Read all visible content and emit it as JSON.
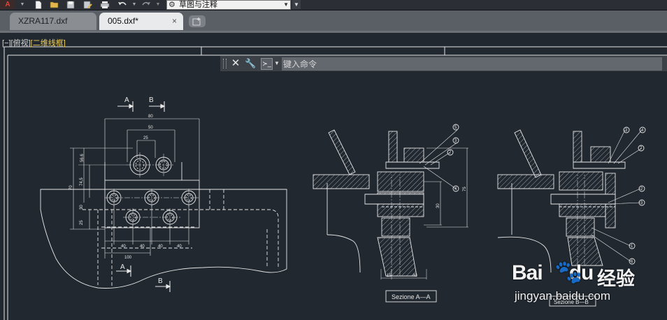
{
  "quick_access": {
    "app_menu_icon": "autocad-app-menu-icon",
    "tools": [
      "new-icon",
      "open-icon",
      "save-icon",
      "saveas-icon",
      "print-icon",
      "undo-icon",
      "redo-icon"
    ]
  },
  "workspace": {
    "label": "草图与注释"
  },
  "tabs": [
    {
      "label": "XZRA117.dxf",
      "active": false
    },
    {
      "label": "005.dxf*",
      "active": true,
      "close": "×"
    }
  ],
  "viewport_label": {
    "controls": "[−]",
    "view": "[俯视]",
    "style": "[二维线框]"
  },
  "command_line": {
    "placeholder": "键入命令"
  },
  "drawing": {
    "front_view": {
      "section_a_tag": "A",
      "section_b_tag": "B",
      "dim_top_80": "80",
      "dim_top_50": "50",
      "dim_top_25": "25",
      "dim_left_56_6": "56.6",
      "dim_left_70": "70",
      "dim_left_74_5": "74,5",
      "dim_left_30": "30",
      "dim_left_25": "25",
      "dim_bottom_40a": "40",
      "dim_bottom_40b": "40",
      "dim_bottom_40c": "40",
      "dim_bottom_40d": "40",
      "dim_bottom_100": "100"
    },
    "section_aa": {
      "balloons": [
        "5",
        "3",
        "7",
        "4"
      ],
      "dim_75": "75",
      "dim_30": "30",
      "dim_15": "15",
      "dim_40": "40",
      "caption": "Sezione  A—A"
    },
    "section_bb": {
      "balloons": [
        "3",
        "4",
        "7",
        "2",
        "3",
        "1",
        "6"
      ],
      "caption": "Sezione  B—B"
    }
  },
  "watermark": {
    "logo": "Bai",
    "logo2": "du",
    "brand": "经验",
    "url": "jingyan.baidu.com"
  },
  "colors": {
    "canvas": "#212830",
    "line": "#e8e8e8",
    "accent_yellow": "#f2d054",
    "tab_active": "#e9eaec"
  }
}
